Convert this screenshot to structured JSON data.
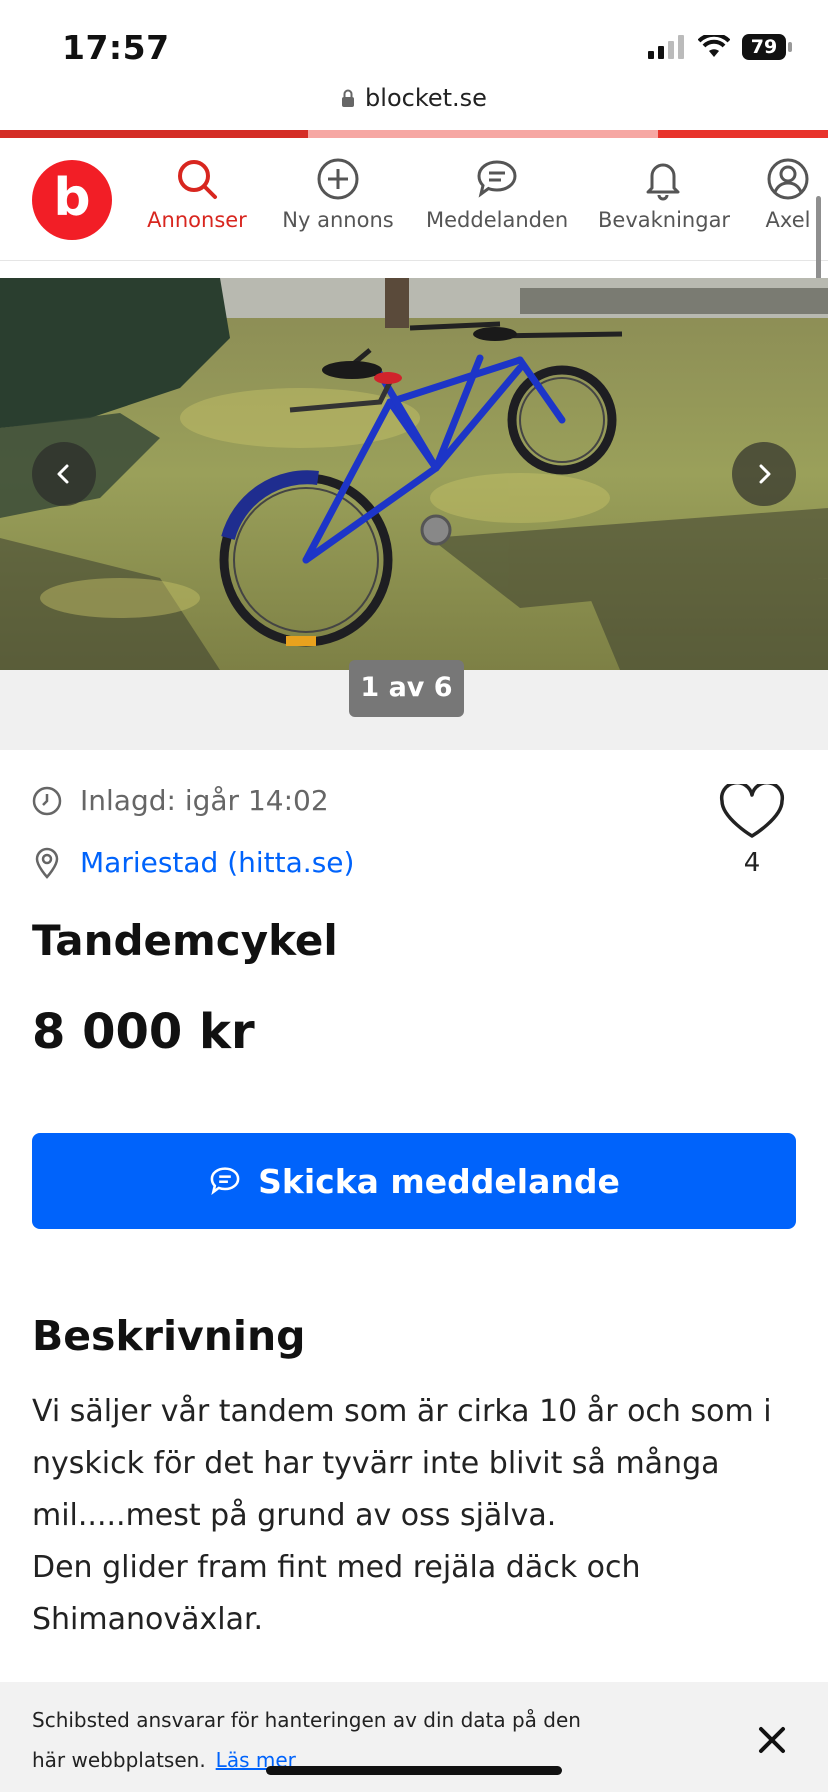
{
  "status_bar": {
    "time": "17:57",
    "battery": "79"
  },
  "browser": {
    "url": "blocket.se"
  },
  "nav": {
    "logo_letter": "b",
    "items": [
      {
        "label": "Annonser",
        "icon": "search-icon",
        "active": true
      },
      {
        "label": "Ny annons",
        "icon": "plus-circle-icon",
        "active": false
      },
      {
        "label": "Meddelanden",
        "icon": "chat-icon",
        "active": false
      },
      {
        "label": "Bevakningar",
        "icon": "bell-icon",
        "active": false
      },
      {
        "label": "Axel",
        "icon": "user-icon",
        "active": false
      }
    ]
  },
  "gallery": {
    "counter": "1 av 6"
  },
  "listing": {
    "posted": "Inlagd: igår 14:02",
    "location": "Mariestad (hitta.se)",
    "favorite_count": "4",
    "title": "Tandemcykel",
    "price": "8 000 kr",
    "send_button": "Skicka meddelande",
    "description_heading": "Beskrivning",
    "description_lines": [
      "Vi säljer vår tandem som är cirka 10 år och som i",
      "nyskick för det har tyvärr inte blivit så många",
      "mil.....mest på grund av oss själva.",
      "Den glider fram fint med rejäla däck och",
      "Shimanoväxlar."
    ]
  },
  "cookie_banner": {
    "text": "Schibsted ansvarar för hanteringen av din data på den här webbplatsen.",
    "link": "Läs mer"
  },
  "colors": {
    "brand_red": "#f21e26",
    "accent_blue": "#0063fb"
  }
}
